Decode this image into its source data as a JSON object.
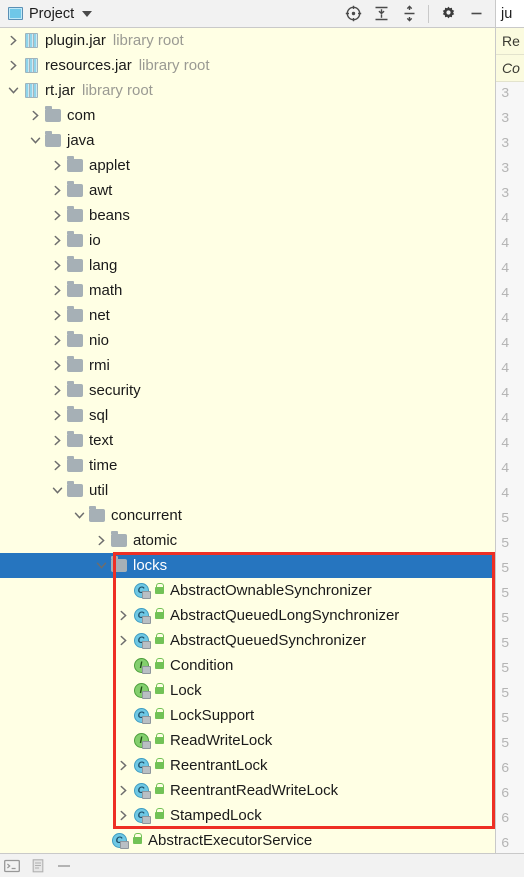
{
  "tool_window": {
    "title": "Project",
    "title_icon": "project-panel-icon",
    "dropdown_icon": "chevron-down-icon",
    "actions": [
      {
        "name": "select-opened-file-button",
        "icon": "crosshair-target-icon"
      },
      {
        "name": "expand-all-button",
        "icon": "expand-all-icon"
      },
      {
        "name": "collapse-all-button",
        "icon": "collapse-all-icon"
      },
      {
        "name": "settings-button",
        "icon": "gear-icon"
      },
      {
        "name": "hide-button",
        "icon": "minimize-icon"
      }
    ]
  },
  "tree": {
    "rows": [
      {
        "label": "plugin.jar",
        "sub": "library root",
        "icon": "jar",
        "depth": 1,
        "arrow": "collapsed"
      },
      {
        "label": "resources.jar",
        "sub": "library root",
        "icon": "jar",
        "depth": 1,
        "arrow": "collapsed"
      },
      {
        "label": "rt.jar",
        "sub": "library root",
        "icon": "jar",
        "depth": 1,
        "arrow": "expanded"
      },
      {
        "label": "com",
        "sub": "",
        "icon": "folder",
        "depth": 2,
        "arrow": "collapsed"
      },
      {
        "label": "java",
        "sub": "",
        "icon": "folder",
        "depth": 2,
        "arrow": "expanded"
      },
      {
        "label": "applet",
        "sub": "",
        "icon": "folder",
        "depth": 3,
        "arrow": "collapsed"
      },
      {
        "label": "awt",
        "sub": "",
        "icon": "folder",
        "depth": 3,
        "arrow": "collapsed"
      },
      {
        "label": "beans",
        "sub": "",
        "icon": "folder",
        "depth": 3,
        "arrow": "collapsed"
      },
      {
        "label": "io",
        "sub": "",
        "icon": "folder",
        "depth": 3,
        "arrow": "collapsed"
      },
      {
        "label": "lang",
        "sub": "",
        "icon": "folder",
        "depth": 3,
        "arrow": "collapsed"
      },
      {
        "label": "math",
        "sub": "",
        "icon": "folder",
        "depth": 3,
        "arrow": "collapsed"
      },
      {
        "label": "net",
        "sub": "",
        "icon": "folder",
        "depth": 3,
        "arrow": "collapsed"
      },
      {
        "label": "nio",
        "sub": "",
        "icon": "folder",
        "depth": 3,
        "arrow": "collapsed"
      },
      {
        "label": "rmi",
        "sub": "",
        "icon": "folder",
        "depth": 3,
        "arrow": "collapsed"
      },
      {
        "label": "security",
        "sub": "",
        "icon": "folder",
        "depth": 3,
        "arrow": "collapsed"
      },
      {
        "label": "sql",
        "sub": "",
        "icon": "folder",
        "depth": 3,
        "arrow": "collapsed"
      },
      {
        "label": "text",
        "sub": "",
        "icon": "folder",
        "depth": 3,
        "arrow": "collapsed"
      },
      {
        "label": "time",
        "sub": "",
        "icon": "folder",
        "depth": 3,
        "arrow": "collapsed"
      },
      {
        "label": "util",
        "sub": "",
        "icon": "folder",
        "depth": 3,
        "arrow": "expanded"
      },
      {
        "label": "concurrent",
        "sub": "",
        "icon": "folder",
        "depth": 4,
        "arrow": "expanded"
      },
      {
        "label": "atomic",
        "sub": "",
        "icon": "folder",
        "depth": 5,
        "arrow": "collapsed"
      },
      {
        "label": "locks",
        "sub": "",
        "icon": "folder",
        "depth": 5,
        "arrow": "expanded",
        "selected": true
      },
      {
        "label": "AbstractOwnableSynchronizer",
        "sub": "",
        "icon": "class",
        "depth": 6,
        "arrow": "none"
      },
      {
        "label": "AbstractQueuedLongSynchronizer",
        "sub": "",
        "icon": "class",
        "depth": 6,
        "arrow": "collapsed"
      },
      {
        "label": "AbstractQueuedSynchronizer",
        "sub": "",
        "icon": "class",
        "depth": 6,
        "arrow": "collapsed"
      },
      {
        "label": "Condition",
        "sub": "",
        "icon": "interface",
        "depth": 6,
        "arrow": "none"
      },
      {
        "label": "Lock",
        "sub": "",
        "icon": "interface",
        "depth": 6,
        "arrow": "none"
      },
      {
        "label": "LockSupport",
        "sub": "",
        "icon": "class",
        "depth": 6,
        "arrow": "none"
      },
      {
        "label": "ReadWriteLock",
        "sub": "",
        "icon": "interface",
        "depth": 6,
        "arrow": "none"
      },
      {
        "label": "ReentrantLock",
        "sub": "",
        "icon": "class",
        "depth": 6,
        "arrow": "collapsed"
      },
      {
        "label": "ReentrantReadWriteLock",
        "sub": "",
        "icon": "class",
        "depth": 6,
        "arrow": "collapsed"
      },
      {
        "label": "StampedLock",
        "sub": "",
        "icon": "class",
        "depth": 6,
        "arrow": "collapsed"
      },
      {
        "label": "AbstractExecutorService",
        "sub": "",
        "icon": "class",
        "depth": 5,
        "arrow": "none"
      }
    ],
    "selected_label": "locks",
    "colors": {
      "background": "#ffffe4",
      "selection": "#2675bf",
      "secondary_text": "#9a9a93"
    }
  },
  "annotation": {
    "color": "#ee2f24",
    "surrounds_from": "locks",
    "surrounds_to": "StampedLock"
  },
  "editor": {
    "tab_label": "ju",
    "crumb_1": "Re",
    "crumb_2": "Co",
    "gutter_lines": [
      "3",
      "3",
      "3",
      "3",
      "3",
      "4",
      "4",
      "4",
      "4",
      "4",
      "4",
      "4",
      "4",
      "4",
      "4",
      "4",
      "4",
      "5",
      "5",
      "5",
      "5",
      "5",
      "5",
      "5",
      "5",
      "5",
      "5",
      "6",
      "6",
      "6",
      "6"
    ]
  },
  "status_bar": {
    "items": [
      {
        "name": "terminal-icon"
      },
      {
        "name": "todo-icon"
      },
      {
        "name": "event-log-icon"
      }
    ]
  }
}
